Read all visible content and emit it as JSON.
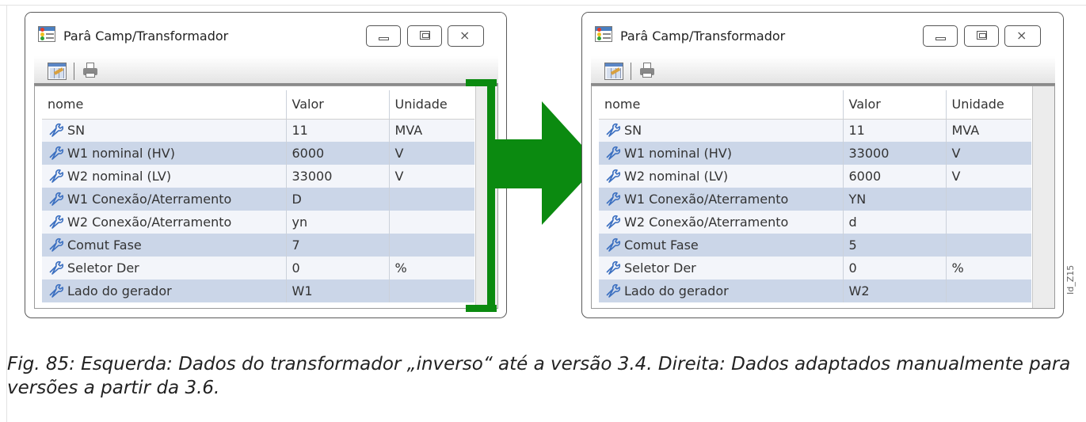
{
  "windows": [
    {
      "title": "Parâ Camp/Transformador",
      "columns": [
        "nome",
        "Valor",
        "Unidade"
      ],
      "rows": [
        {
          "name": "SN",
          "value": "11",
          "unit": "MVA"
        },
        {
          "name": "W1 nominal (HV)",
          "value": "6000",
          "unit": "V"
        },
        {
          "name": "W2 nominal (LV)",
          "value": "33000",
          "unit": "V"
        },
        {
          "name": "W1 Conexão/Aterramento",
          "value": "D",
          "unit": ""
        },
        {
          "name": "W2 Conexão/Aterramento",
          "value": "yn",
          "unit": ""
        },
        {
          "name": "Comut Fase",
          "value": "7",
          "unit": ""
        },
        {
          "name": "Seletor Der",
          "value": "0",
          "unit": "%"
        },
        {
          "name": "Lado do gerador",
          "value": "W1",
          "unit": ""
        }
      ]
    },
    {
      "title": "Parâ Camp/Transformador",
      "columns": [
        "nome",
        "Valor",
        "Unidade"
      ],
      "rows": [
        {
          "name": "SN",
          "value": "11",
          "unit": "MVA"
        },
        {
          "name": "W1 nominal (HV)",
          "value": "33000",
          "unit": "V"
        },
        {
          "name": "W2 nominal (LV)",
          "value": "6000",
          "unit": "V"
        },
        {
          "name": "W1 Conexão/Aterramento",
          "value": "YN",
          "unit": ""
        },
        {
          "name": "W2 Conexão/Aterramento",
          "value": "d",
          "unit": ""
        },
        {
          "name": "Comut Fase",
          "value": "5",
          "unit": ""
        },
        {
          "name": "Seletor Der",
          "value": "0",
          "unit": "%"
        },
        {
          "name": "Lado do gerador",
          "value": "W2",
          "unit": ""
        }
      ]
    }
  ],
  "figure_id": "Id_Z15",
  "caption": "Fig. 85: Esquerda: Dados do transformador „inverso“ até a versão 3.4. Direita: Dados adaptados manualmente para versões a partir da 3.6.",
  "colors": {
    "arrow": "#0b8a10",
    "row_alt": "#cbd6e8",
    "row_light": "#f3f5fa"
  },
  "icons": [
    "app-window-icon",
    "table-view-icon",
    "print-icon",
    "wrench-icon",
    "minimize-icon",
    "maximize-icon",
    "close-icon",
    "right-arrow-icon"
  ]
}
